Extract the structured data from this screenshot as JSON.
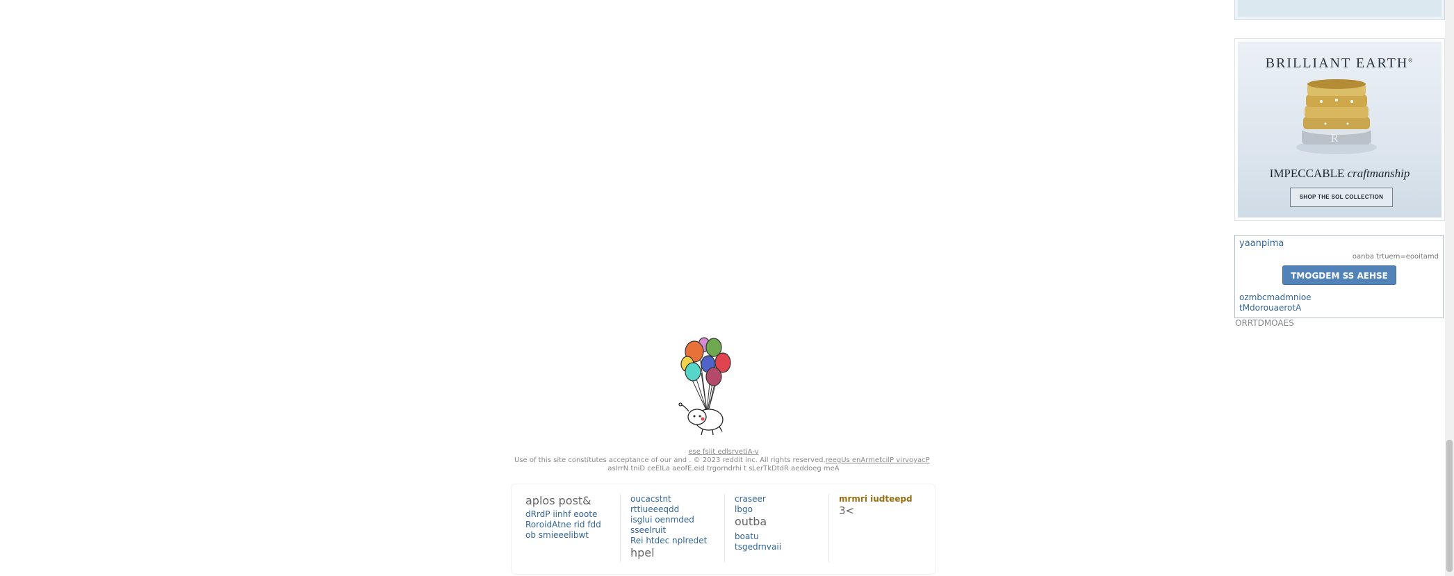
{
  "sidebar": {
    "ad": {
      "brand": "BRILLIANT EARTH",
      "trademark": "®",
      "tagline_plain": "IMPECCABLE",
      "tagline_italic": "craftmanship",
      "cta": "SHOP THE SOL COLLECTION"
    },
    "moderation": {
      "title": "yaanpima",
      "small_text": "oanba trtuem=eooitamd",
      "button": "TMOGDEM SS AEHSE",
      "link1": "ozmbcmadmnioe",
      "link2": "tMdorouaerotA"
    },
    "below_text": "ORRTDMOAES"
  },
  "footer": {
    "line1": "ese fslit edlsrvetiA-v",
    "line2_text": "Use of this site constitutes acceptance of our and . © 2023 reddit inc. All rights reserved.",
    "line2_link": "reegUs enArmetcilP virvoyacP",
    "line3": "asIrrN tniD ceEILa aeofE.eid trgorndrhi t sLerTkDtdR aeddoeg meA",
    "columns": {
      "col1": {
        "heading": "aplos post&",
        "links": [
          "dRrdP iinhf eoote",
          "RoroidAtne rid fdd",
          "ob smieeelibwt"
        ]
      },
      "col2": {
        "links": [
          "oucacstnt",
          "rttiueeeqdd",
          "isglui oenmded",
          "sseelruit",
          "Rei htdec nplredet"
        ],
        "big": "hpel"
      },
      "col3": {
        "links_a": [
          "craseer",
          "lbgo"
        ],
        "big": "outba",
        "links_b": [
          "boatu",
          "tsgedrnvaii"
        ]
      },
      "col4": {
        "gold": "mrmri iudteepd",
        "num": "3<"
      }
    }
  },
  "colors": {
    "link": "#336699",
    "button": "#5183b8",
    "gold": "#9a6e12"
  }
}
